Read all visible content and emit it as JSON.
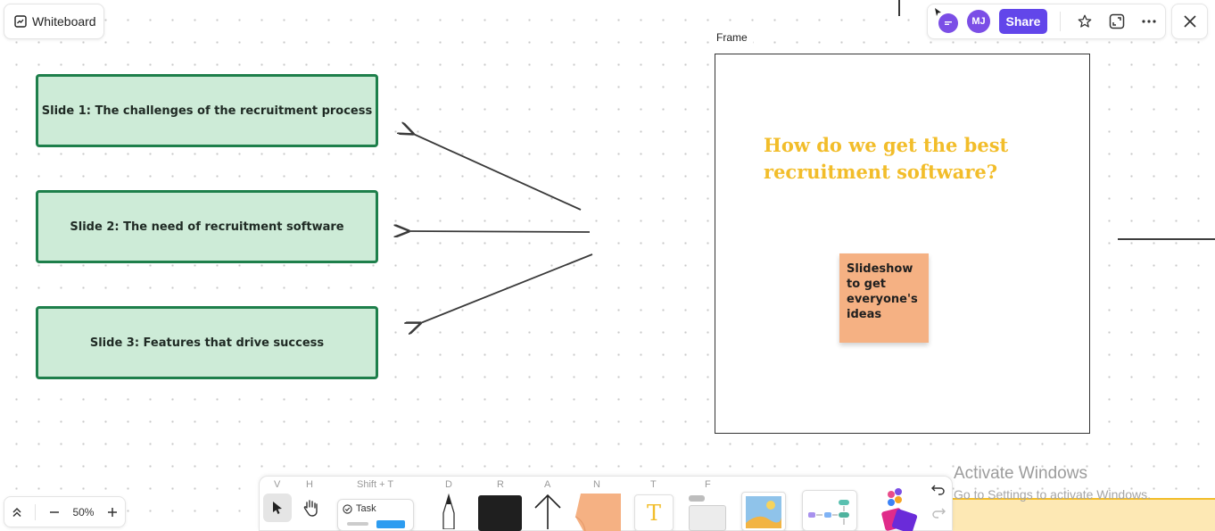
{
  "header": {
    "title": "Whiteboard"
  },
  "slides": [
    {
      "label": "Slide 1: The challenges of the recruitment process"
    },
    {
      "label": "Slide 2: The need of recruitment software"
    },
    {
      "label": "Slide 3: Features that drive success"
    }
  ],
  "frame": {
    "label": "Frame",
    "title": "How do we get the best recruitment software?",
    "sticky_note": "Slideshow to get everyone's ideas"
  },
  "top_toolbar": {
    "avatar_initials": "MJ",
    "share_label": "Share"
  },
  "zoom": {
    "level": "50%"
  },
  "bottom_toolbar": {
    "shortcuts": {
      "select": "V",
      "hand": "H",
      "task": "Shift + T",
      "draw": "D",
      "rectangle": "R",
      "arrow": "A",
      "note": "N",
      "text": "T",
      "frame": "F"
    },
    "task_label": "Task",
    "text_glyph": "T"
  },
  "watermark": {
    "line1": "Activate Windows",
    "line2": "Go to Settings to activate Windows."
  },
  "colors": {
    "slide_fill": "#cdebd7",
    "slide_border": "#1e7f4b",
    "frame_title": "#f2bd2a",
    "sticky": "#f5b183",
    "accent": "#6246ea"
  }
}
